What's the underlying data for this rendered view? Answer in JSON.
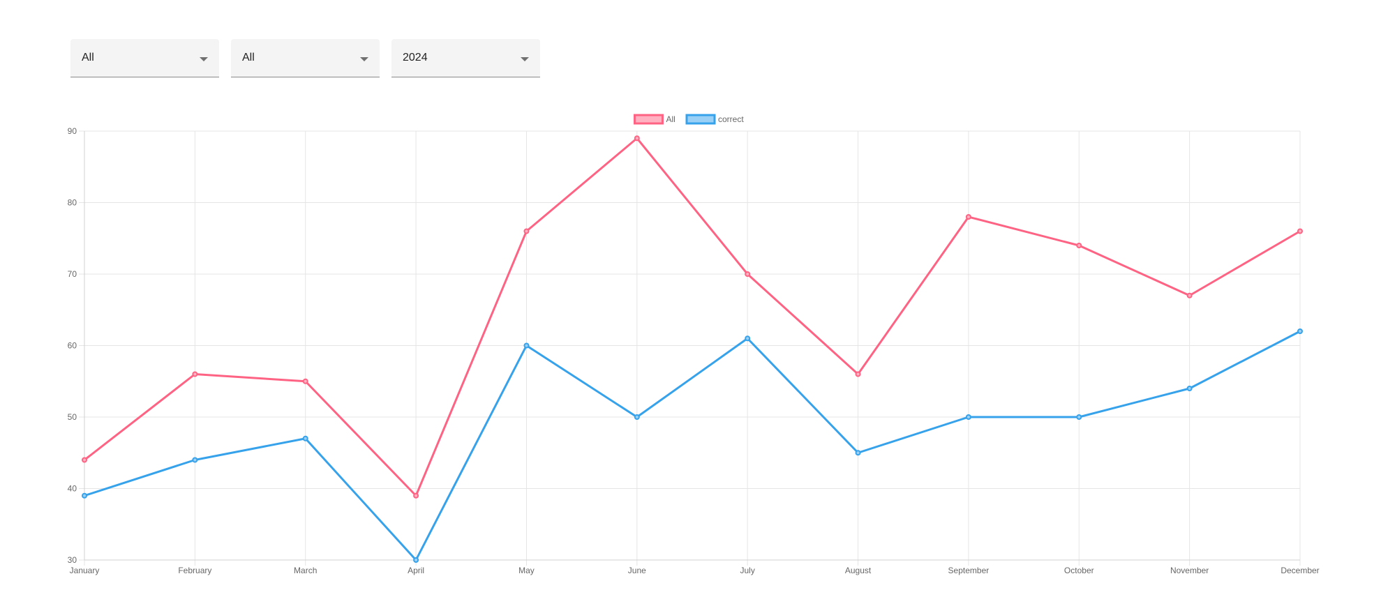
{
  "filters": [
    {
      "selected": "All"
    },
    {
      "selected": "All"
    },
    {
      "selected": "2024"
    }
  ],
  "chart_data": {
    "type": "line",
    "categories": [
      "January",
      "February",
      "March",
      "April",
      "May",
      "June",
      "July",
      "August",
      "September",
      "October",
      "November",
      "December"
    ],
    "series": [
      {
        "name": "All",
        "color": "#ff6384",
        "fill": "#ffb1c1",
        "values": [
          44,
          56,
          55,
          39,
          76,
          89,
          70,
          56,
          78,
          74,
          67,
          76
        ]
      },
      {
        "name": "correct",
        "color": "#36a2eb",
        "fill": "#9ad0f5",
        "values": [
          39,
          44,
          47,
          30,
          60,
          50,
          61,
          45,
          50,
          50,
          54,
          62
        ]
      }
    ],
    "yticks": [
      30,
      40,
      50,
      60,
      70,
      80,
      90
    ],
    "ylim": [
      30,
      90
    ],
    "grid": true,
    "legend": "top-center"
  }
}
